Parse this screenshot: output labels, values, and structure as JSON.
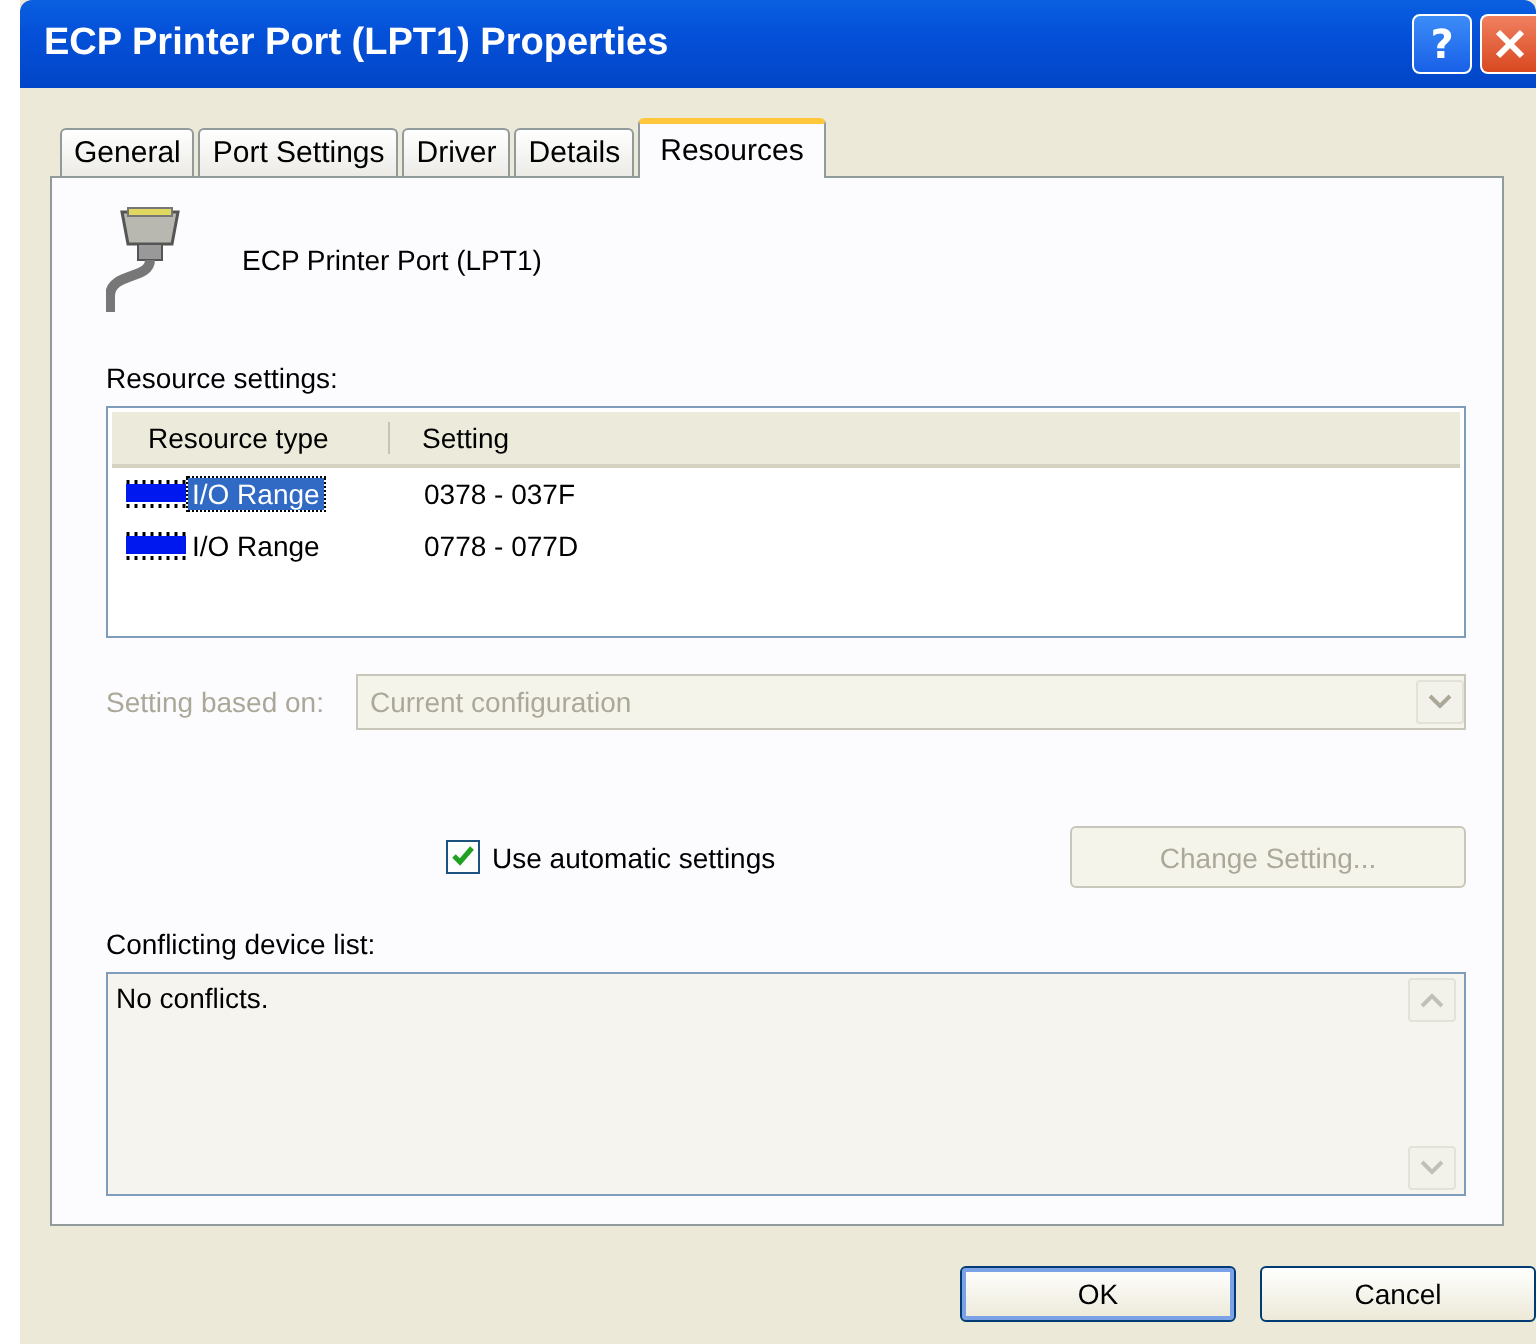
{
  "window": {
    "title": "ECP Printer Port (LPT1) Properties",
    "help_button": "?"
  },
  "tabs": [
    {
      "label": "General",
      "selected": false
    },
    {
      "label": "Port Settings",
      "selected": false
    },
    {
      "label": "Driver",
      "selected": false
    },
    {
      "label": "Details",
      "selected": false
    },
    {
      "label": "Resources",
      "selected": true
    }
  ],
  "device_name": "ECP Printer Port (LPT1)",
  "resource_settings": {
    "label": "Resource settings:",
    "columns": [
      "Resource type",
      "Setting"
    ],
    "rows": [
      {
        "type": "I/O Range",
        "setting": "0378 - 037F",
        "selected": true
      },
      {
        "type": "I/O Range",
        "setting": "0778 - 077D",
        "selected": false
      }
    ]
  },
  "setting_based_on": {
    "label": "Setting based on:",
    "value": "Current configuration",
    "disabled": true
  },
  "use_automatic_settings": {
    "label": "Use automatic settings",
    "checked": true
  },
  "change_setting": {
    "label": "Change Setting...",
    "disabled": true
  },
  "conflicts": {
    "label": "Conflicting device list:",
    "text": "No conflicts."
  },
  "buttons": [
    {
      "label": "OK",
      "default": true
    },
    {
      "label": "Cancel",
      "default": false
    }
  ]
}
